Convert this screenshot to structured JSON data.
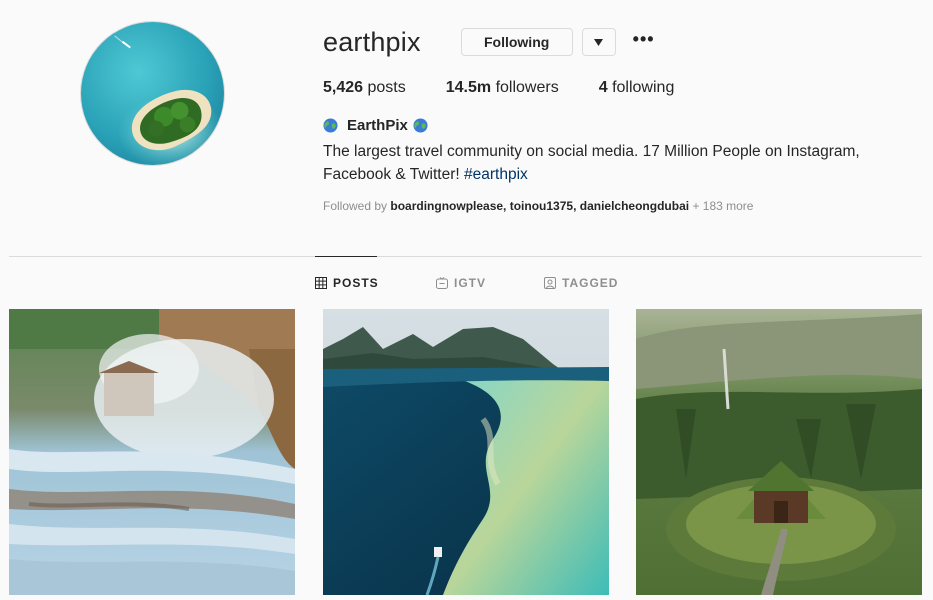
{
  "profile": {
    "username": "earthpix",
    "follow_label": "Following",
    "more_label": "•••",
    "full_name": "EarthPix",
    "bio_text": "The largest travel community on social media. 17 Million People on Instagram, Facebook & Twitter!",
    "bio_hashtag": "#earthpix"
  },
  "stats": {
    "posts_count": "5,426",
    "posts_label": "posts",
    "followers_count": "14.5m",
    "followers_label": "followers",
    "following_count": "4",
    "following_label": "following"
  },
  "followed_by": {
    "prefix": "Followed by",
    "names": "boardingnowplease, toinou1375, danielcheongdubai",
    "more": "+ 183 more"
  },
  "tabs": [
    {
      "label": "POSTS",
      "icon": "grid-icon",
      "active": true
    },
    {
      "label": "IGTV",
      "icon": "igtv-icon",
      "active": false
    },
    {
      "label": "TAGGED",
      "icon": "tagged-icon",
      "active": false
    }
  ],
  "posts": [
    {
      "subject": "thermal-terraces-photo"
    },
    {
      "subject": "lagoon-coastline-photo"
    },
    {
      "subject": "turf-house-photo"
    }
  ],
  "colors": {
    "text": "#262626",
    "secondary": "#8e8e8e",
    "border": "#dbdbdb",
    "hashtag": "#003569",
    "background": "#fafafa"
  }
}
